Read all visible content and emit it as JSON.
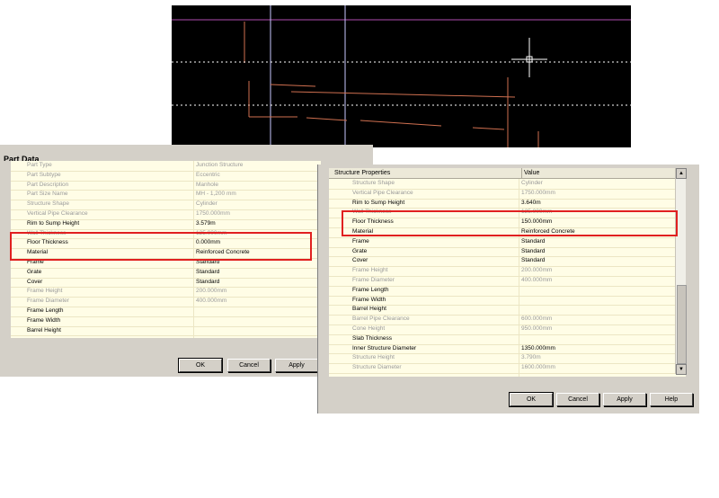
{
  "colors": {
    "highlight": "#e02020",
    "grid_bg": "#fffde6",
    "cad_bg": "#000000"
  },
  "left_dialog": {
    "section_title": "Part Data",
    "rows": [
      {
        "name": "Part Type",
        "value": "Junction Structure",
        "editable": false
      },
      {
        "name": "Part Subtype",
        "value": "Eccentric",
        "editable": false
      },
      {
        "name": "Part Description",
        "value": "Manhole",
        "editable": false
      },
      {
        "name": "Part Size Name",
        "value": "MH - 1,200 mm",
        "editable": false
      },
      {
        "name": "Structure Shape",
        "value": "Cylinder",
        "editable": false
      },
      {
        "name": "Vertical Pipe Clearance",
        "value": "1750.000mm",
        "editable": false
      },
      {
        "name": "Rim to Sump Height",
        "value": "3.579m",
        "editable": true
      },
      {
        "name": "Wall Thickness",
        "value": "125.000mm",
        "editable": false
      },
      {
        "name": "Floor Thickness",
        "value": "0.000mm",
        "editable": true
      },
      {
        "name": "Material",
        "value": "Reinforced Concrete",
        "editable": true
      },
      {
        "name": "Frame",
        "value": "Standard",
        "editable": true
      },
      {
        "name": "Grate",
        "value": "Standard",
        "editable": true
      },
      {
        "name": "Cover",
        "value": "Standard",
        "editable": true
      },
      {
        "name": "Frame Height",
        "value": "200.000mm",
        "editable": false
      },
      {
        "name": "Frame Diameter",
        "value": "400.000mm",
        "editable": false
      },
      {
        "name": "Frame Length",
        "value": "",
        "editable": true
      },
      {
        "name": "Frame Width",
        "value": "",
        "editable": true
      },
      {
        "name": "Barrel Height",
        "value": "",
        "editable": true
      }
    ],
    "buttons": {
      "ok": "OK",
      "cancel": "Cancel",
      "apply": "Apply"
    }
  },
  "right_dialog": {
    "col_property": "Structure Properties",
    "col_value": "Value",
    "rows": [
      {
        "name": "Structure Shape",
        "value": "Cylinder",
        "editable": false
      },
      {
        "name": "Vertical Pipe Clearance",
        "value": "1750.000mm",
        "editable": false
      },
      {
        "name": "Rim to Sump Height",
        "value": "3.640m",
        "editable": true
      },
      {
        "name": "Wall Thickness",
        "value": "125.000mm",
        "editable": false
      },
      {
        "name": "Floor Thickness",
        "value": "150.000mm",
        "editable": true
      },
      {
        "name": "Material",
        "value": "Reinforced Concrete",
        "editable": true
      },
      {
        "name": "Frame",
        "value": "Standard",
        "editable": true
      },
      {
        "name": "Grate",
        "value": "Standard",
        "editable": true
      },
      {
        "name": "Cover",
        "value": "Standard",
        "editable": true
      },
      {
        "name": "Frame Height",
        "value": "200.000mm",
        "editable": false
      },
      {
        "name": "Frame Diameter",
        "value": "400.000mm",
        "editable": false
      },
      {
        "name": "Frame Length",
        "value": "",
        "editable": true
      },
      {
        "name": "Frame Width",
        "value": "",
        "editable": true
      },
      {
        "name": "Barrel Height",
        "value": "",
        "editable": true
      },
      {
        "name": "Barrel Pipe Clearance",
        "value": "600.000mm",
        "editable": false
      },
      {
        "name": "Cone Height",
        "value": "950.000mm",
        "editable": false
      },
      {
        "name": "Slab Thickness",
        "value": "",
        "editable": true
      },
      {
        "name": "Inner Structure Diameter",
        "value": "1350.000mm",
        "editable": true
      },
      {
        "name": "Structure Height",
        "value": "3.790m",
        "editable": false
      },
      {
        "name": "Structure Diameter",
        "value": "1600.000mm",
        "editable": false
      }
    ],
    "buttons": {
      "ok": "OK",
      "cancel": "Cancel",
      "apply": "Apply",
      "help": "Help"
    }
  }
}
